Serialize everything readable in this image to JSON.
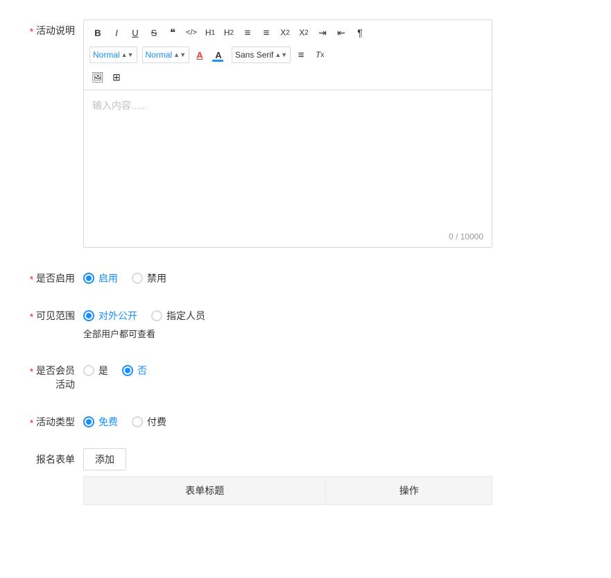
{
  "form": {
    "activity_description_label": "活动说明",
    "required_marker": "*",
    "toolbar": {
      "bold": "B",
      "italic": "I",
      "underline": "U",
      "strikethrough": "S",
      "quote": "\"\"",
      "code": "</>",
      "h1": "H₁",
      "h2": "H₂",
      "ol": "≡",
      "ul": "≡",
      "sub": "X₂",
      "sup": "X²",
      "indent_right": "⇥",
      "indent_left": "⇤",
      "pilcrow": "¶",
      "select1_label": "Normal",
      "select2_label": "Normal",
      "font_color": "A",
      "font_highlight": "A̲",
      "font_family": "Sans Serif",
      "align": "≡",
      "clear_format": "Tx",
      "image": "🖼",
      "table": "⊞"
    },
    "editor_placeholder": "输入内容......",
    "counter": "0 / 10000",
    "enable_label": "是否启用",
    "enable_options": [
      {
        "label": "启用",
        "checked": true
      },
      {
        "label": "禁用",
        "checked": false
      }
    ],
    "visibility_label": "可见范围",
    "visibility_options": [
      {
        "label": "对外公开",
        "checked": true,
        "blue": true
      },
      {
        "label": "指定人员",
        "checked": false
      }
    ],
    "visibility_hint": "全部用户都可查看",
    "member_activity_label": "是否会员活动",
    "member_activity_options": [
      {
        "label": "是",
        "checked": false
      },
      {
        "label": "否",
        "checked": true,
        "blue": true
      }
    ],
    "activity_type_label": "活动类型",
    "activity_type_options": [
      {
        "label": "免费",
        "checked": true,
        "blue": true
      },
      {
        "label": "付费",
        "checked": false
      }
    ],
    "form_list_label": "报名表单",
    "add_button": "添加",
    "table_headers": [
      "表单标题",
      "操作"
    ]
  }
}
